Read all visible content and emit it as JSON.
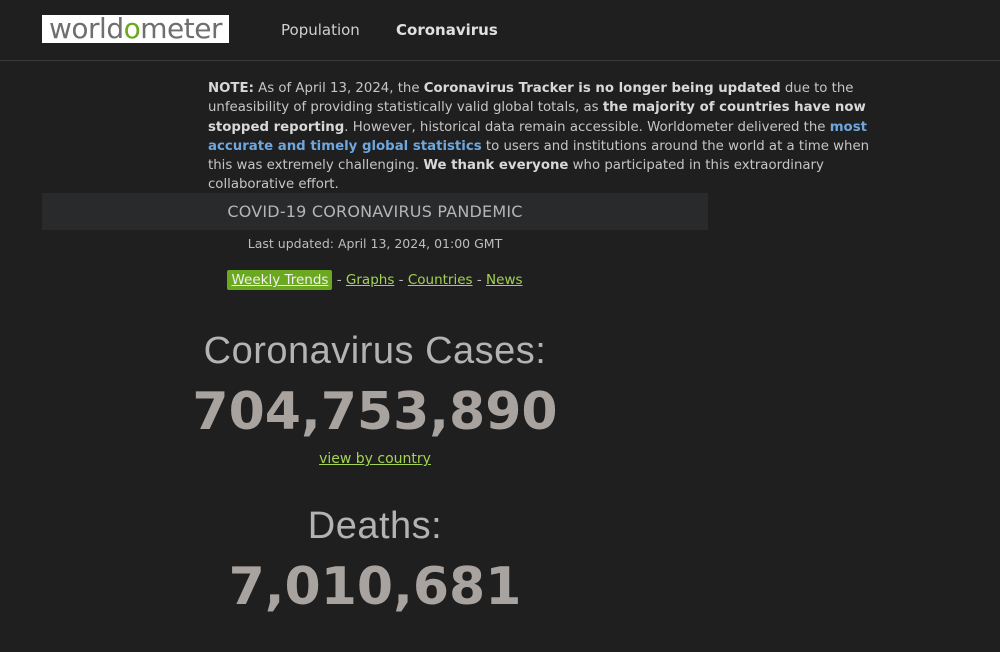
{
  "header": {
    "logo_text_pre": "worldometer",
    "nav": [
      {
        "label": "Population"
      },
      {
        "label": "Coronavirus"
      }
    ]
  },
  "note": {
    "prefix": "NOTE:",
    "t1": " As of April 13, 2024, the ",
    "b1": "Coronavirus Tracker is no longer being updated",
    "t2": " due to the unfeasibility of providing statistically valid global totals, as ",
    "b2": "the majority of countries have now stopped reporting",
    "t3": ". However, historical data remain accessible. Worldometer delivered the ",
    "link": "most accurate and timely global statistics",
    "t4": " to users and institutions around the world at a time when this was extremely challenging. ",
    "b3": "We thank everyone",
    "t5": " who participated in this extraordinary collaborative effort."
  },
  "banner": {
    "title": "COVID-19 CORONAVIRUS PANDEMIC",
    "updated": "Last updated: April 13, 2024, 01:00 GMT"
  },
  "tabs": [
    {
      "label": "Weekly Trends"
    },
    {
      "label": "Graphs"
    },
    {
      "label": "Countries"
    },
    {
      "label": "News"
    }
  ],
  "tab_separator": " - ",
  "counters": {
    "cases_label": "Coronavirus Cases:",
    "cases_value": "704,753,890",
    "view_link": "view by country",
    "deaths_label": "Deaths:",
    "deaths_value": "7,010,681"
  },
  "colors": {
    "background": "#1f1f20",
    "accent_green": "#6aa820",
    "link_green": "#a3d255",
    "link_blue": "#6fa6dc"
  }
}
